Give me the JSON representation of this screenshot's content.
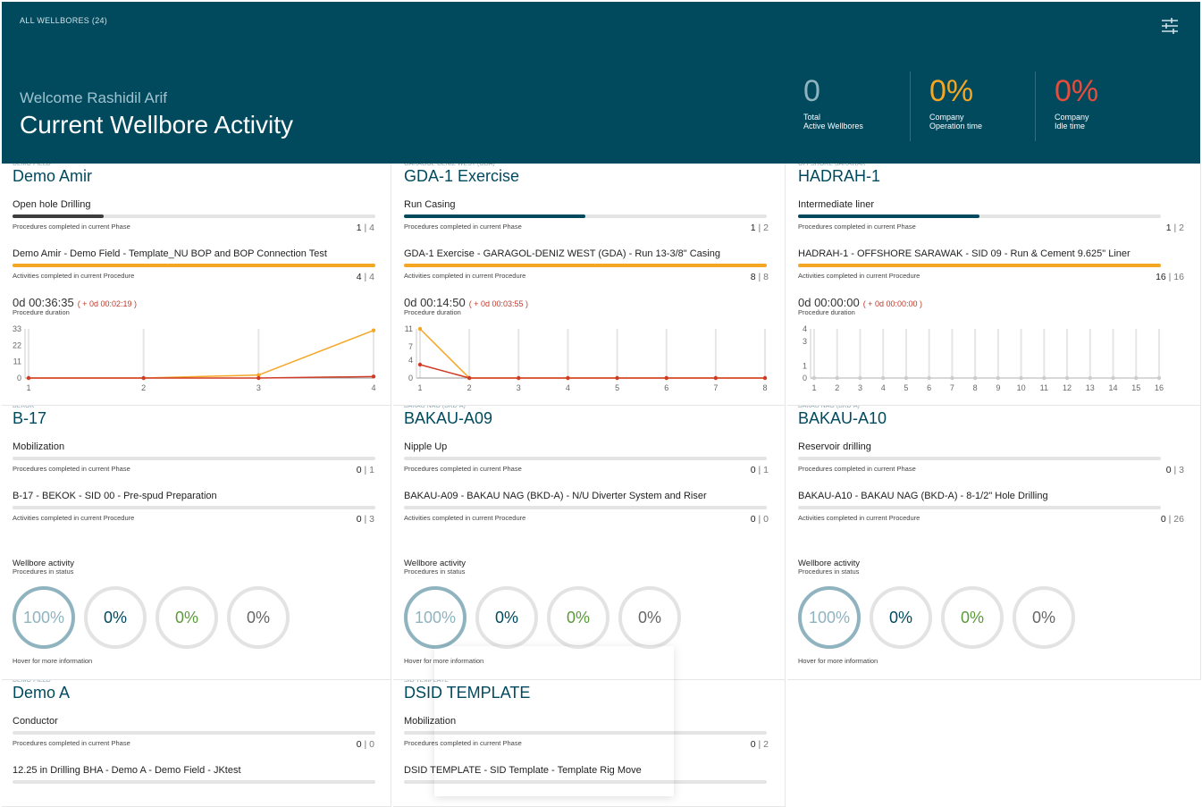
{
  "header": {
    "crumb": "ALL WELLBORES (24)",
    "welcome": "Welcome Rashidil Arif",
    "title": "Current Wellbore Activity",
    "stats": [
      {
        "value": "0",
        "label": "Total\nActive Wellbores",
        "color": "#8fb3bf"
      },
      {
        "value": "0%",
        "label": "Company\nOperation time",
        "color": "#f5a623"
      },
      {
        "value": "0%",
        "label": "Company\nIdle time",
        "color": "#e74c3c"
      }
    ]
  },
  "labels": {
    "procedures_phase": "Procedures completed in current Phase",
    "activities_procedure": "Activities completed in current Procedure",
    "procedure_duration": "Procedure duration",
    "wellbore_activity": "Wellbore activity",
    "procedures_status": "Procedures in status",
    "hover_hint": "Hover for more information"
  },
  "cards": [
    {
      "field": "DEMO FIELD",
      "name": "Demo Amir",
      "phase": "Open hole Drilling",
      "phase_done": "1",
      "phase_total": "4",
      "phase_fraction": 0.25,
      "phase_color": "#3d3d3d",
      "procedure": "Demo Amir - Demo Field - Template_NU BOP and BOP Connection Test",
      "act_done": "4",
      "act_total": "4",
      "act_fraction": 1.0,
      "act_color": "#f5a623",
      "duration": "0d 00:36:35",
      "delta": "( + 0d 00:02:19 )"
    },
    {
      "field": "GARAGOL-DENIZ WEST (GDA)",
      "name": "GDA-1 Exercise",
      "phase": "Run Casing",
      "phase_done": "1",
      "phase_total": "2",
      "phase_fraction": 0.5,
      "phase_color": "#014a5e",
      "procedure": "GDA-1 Exercise - GARAGOL-DENIZ WEST (GDA) - Run 13-3/8\" Casing",
      "act_done": "8",
      "act_total": "8",
      "act_fraction": 1.0,
      "act_color": "#f5a623",
      "duration": "0d 00:14:50",
      "delta": "( + 0d 00:03:55 )"
    },
    {
      "field": "OFFSHORE SARAWAK",
      "name": "HADRAH-1",
      "phase": "Intermediate liner",
      "phase_done": "1",
      "phase_total": "2",
      "phase_fraction": 0.5,
      "phase_color": "#014a5e",
      "procedure": "HADRAH-1 - OFFSHORE SARAWAK - SID 09 - Run & Cement 9.625\" Liner",
      "act_done": "16",
      "act_total": "16",
      "act_fraction": 1.0,
      "act_color": "#f5a623",
      "duration": "0d 00:00:00",
      "delta": "( + 0d 00:00:00 )"
    },
    {
      "field": "BEKOK",
      "name": "B-17",
      "phase": "Mobilization",
      "phase_done": "0",
      "phase_total": "1",
      "phase_fraction": 0,
      "procedure": "B-17 - BEKOK - SID 00 - Pre-spud Preparation",
      "act_done": "0",
      "act_total": "3",
      "act_fraction": 0,
      "rings": [
        "100%",
        "0%",
        "0%",
        "0%"
      ]
    },
    {
      "field": "BAKAU NAG (BKD-A)",
      "name": "BAKAU-A09",
      "phase": "Nipple Up",
      "phase_done": "0",
      "phase_total": "1",
      "phase_fraction": 0,
      "procedure": "BAKAU-A09 - BAKAU NAG (BKD-A) - N/U Diverter System and Riser",
      "act_done": "0",
      "act_total": "0",
      "act_fraction": 0,
      "rings": [
        "100%",
        "0%",
        "0%",
        "0%"
      ]
    },
    {
      "field": "BAKAU NAG (BKD-A)",
      "name": "BAKAU-A10",
      "phase": "Reservoir drilling",
      "phase_done": "0",
      "phase_total": "3",
      "phase_fraction": 0,
      "procedure": "BAKAU-A10 - BAKAU NAG (BKD-A) - 8-1/2\" Hole Drilling",
      "act_done": "0",
      "act_total": "26",
      "act_fraction": 0,
      "rings": [
        "100%",
        "0%",
        "0%",
        "0%"
      ]
    },
    {
      "field": "DEMO FIELD",
      "name": "Demo A",
      "phase": "Conductor",
      "phase_done": "0",
      "phase_total": "0",
      "phase_fraction": 0,
      "procedure": "12.25 in Drilling BHA - Demo A - Demo Field - JKtest"
    },
    {
      "field": "SID TEMPLATE",
      "name": "DSID TEMPLATE",
      "phase": "Mobilization",
      "phase_done": "0",
      "phase_total": "2",
      "phase_fraction": 0,
      "procedure": "DSID TEMPLATE - SID Template - Template Rig Move"
    }
  ],
  "ring_colors": [
    "#8fb3bf",
    "#014a5e",
    "#5a9a3a",
    "#666666"
  ],
  "chart_data": [
    {
      "type": "line",
      "x": [
        1,
        2,
        3,
        4
      ],
      "yticks": [
        0,
        11,
        22,
        33
      ],
      "ylim": [
        0,
        33
      ],
      "series": [
        {
          "values": [
            0,
            0,
            2,
            32
          ],
          "color": "#f5a623"
        },
        {
          "values": [
            0,
            0,
            0,
            1
          ],
          "color": "#d13a25"
        }
      ]
    },
    {
      "type": "line",
      "x": [
        1,
        2,
        3,
        4,
        5,
        6,
        7,
        8
      ],
      "yticks": [
        0,
        4,
        7,
        11
      ],
      "ylim": [
        0,
        11
      ],
      "series": [
        {
          "values": [
            11,
            0,
            0,
            0,
            0,
            0,
            0,
            0
          ],
          "color": "#f5a623"
        },
        {
          "values": [
            3,
            0,
            0,
            0,
            0,
            0,
            0,
            0
          ],
          "color": "#d13a25"
        }
      ]
    },
    {
      "type": "line",
      "x": [
        1,
        2,
        3,
        4,
        5,
        6,
        7,
        8,
        9,
        10,
        11,
        12,
        13,
        14,
        15,
        16
      ],
      "yticks": [
        0,
        1,
        3,
        4
      ],
      "ylim": [
        0,
        4
      ],
      "series": [
        {
          "values": [
            0,
            0,
            0,
            0,
            0,
            0,
            0,
            0,
            0,
            0,
            0,
            0,
            0,
            0,
            0,
            0
          ],
          "color": "#cccccc"
        }
      ]
    }
  ]
}
